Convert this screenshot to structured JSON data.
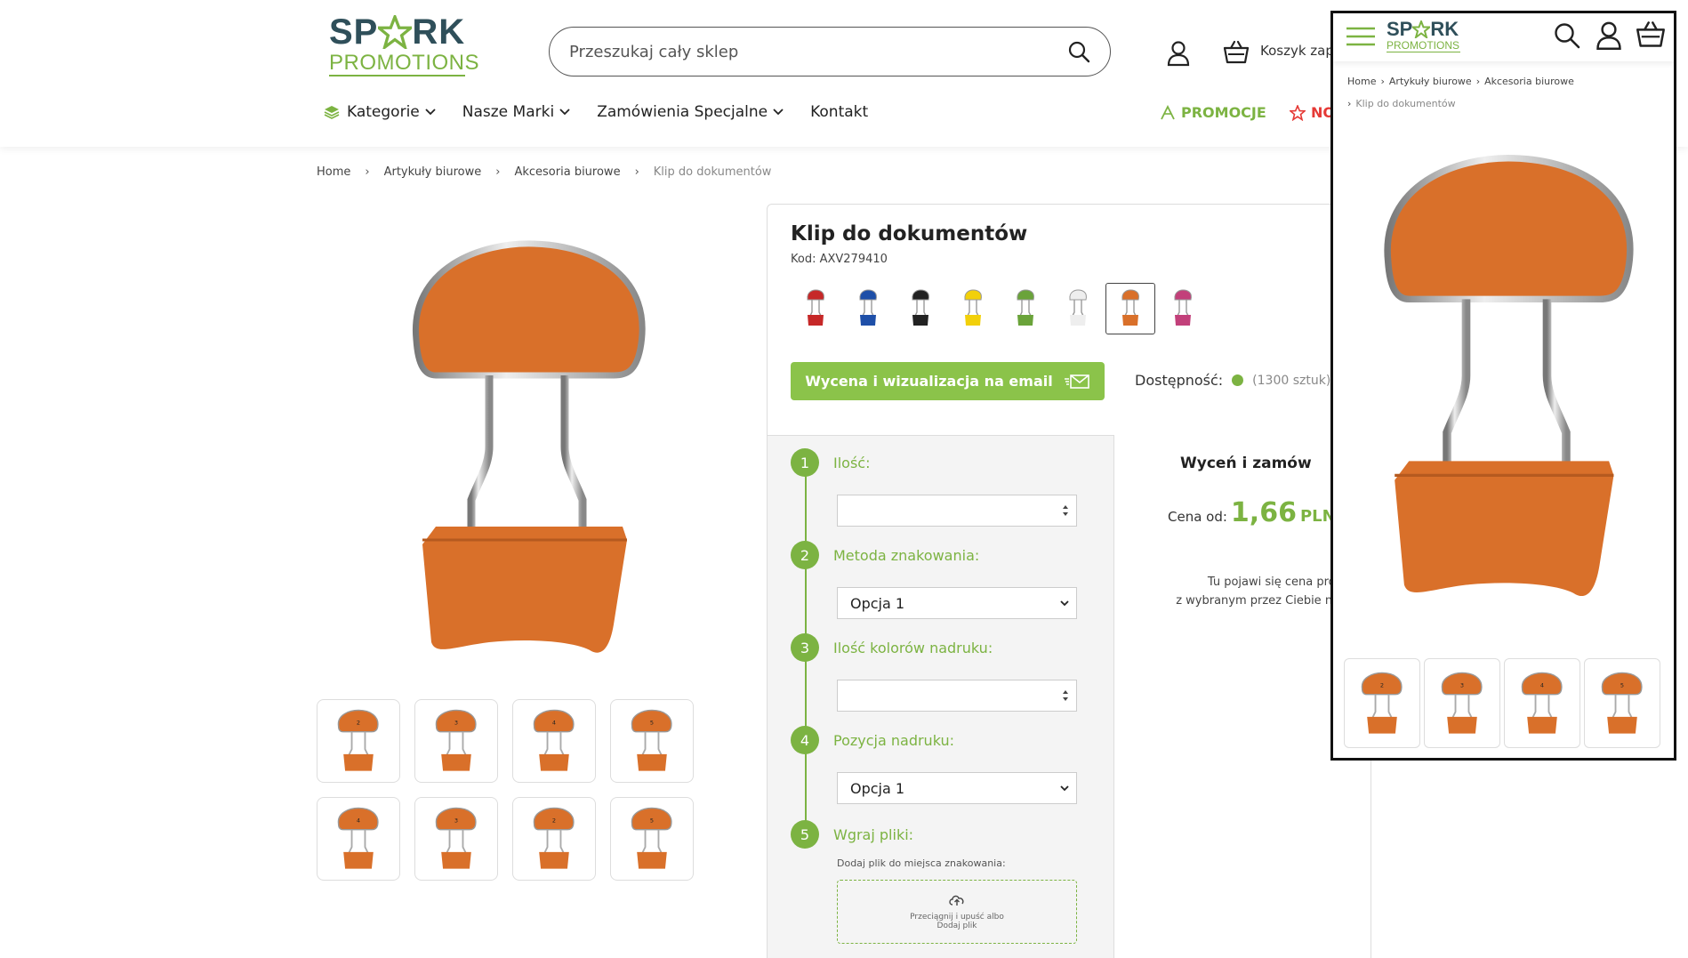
{
  "colors": {
    "accent": "#7cb342",
    "accent_btn": "#8bc34a",
    "logo_dark": "#2f4f5a",
    "product_orange": "#d9702a",
    "new_red": "#e53935"
  },
  "header": {
    "logo_top": "SP★RK",
    "logo_bottom": "PROMOTIONS",
    "search_placeholder": "Przeszukaj cały sklep",
    "cart_label": "Koszyk zap"
  },
  "nav": {
    "items": [
      {
        "label": "Kategorie",
        "icon": "layers-icon",
        "dropdown": true
      },
      {
        "label": "Nasze Marki",
        "dropdown": true
      },
      {
        "label": "Zamówienia Specjalne",
        "dropdown": true
      },
      {
        "label": "Kontakt",
        "dropdown": false
      }
    ],
    "promo_label": "PROMOCJE",
    "new_label": "NO"
  },
  "breadcrumb": [
    "Home",
    "Artykuły biurowe",
    "Akcesoria biurowe",
    "Klip do dokumentów"
  ],
  "gallery": {
    "thumb_numbers": [
      "2",
      "3",
      "4",
      "5",
      "4",
      "3",
      "2",
      "5"
    ]
  },
  "product": {
    "title": "Klip do dokumentów",
    "code": "Kod: AXV279410",
    "swatches": [
      {
        "name": "red",
        "color": "#c62828"
      },
      {
        "name": "blue",
        "color": "#1e4fa8"
      },
      {
        "name": "black",
        "color": "#222222"
      },
      {
        "name": "yellow",
        "color": "#f2d00a"
      },
      {
        "name": "green",
        "color": "#6aa33a"
      },
      {
        "name": "white",
        "color": "#eeeeee"
      },
      {
        "name": "orange",
        "color": "#d9702a",
        "selected": true
      },
      {
        "name": "pink",
        "color": "#c2407a"
      }
    ],
    "cta_label": "Wycena i wizualizacja na email",
    "availability_label": "Dostępność:",
    "availability_stock": "(1300 sztuk)"
  },
  "form": {
    "steps": [
      {
        "num": "1",
        "label": "Ilość:",
        "type": "number",
        "value": ""
      },
      {
        "num": "2",
        "label": "Metoda znakowania:",
        "type": "select",
        "value": "Opcja 1"
      },
      {
        "num": "3",
        "label": "Ilość kolorów nadruku:",
        "type": "number",
        "value": ""
      },
      {
        "num": "4",
        "label": "Pozycja nadruku:",
        "type": "select",
        "value": "Opcja 1"
      },
      {
        "num": "5",
        "label": "Wgraj pliki:",
        "type": "upload"
      }
    ],
    "upload_hint": "Dodaj plik do miejsca znakowania:",
    "dropzone_line1": "Przeciągnij i upuść albo",
    "dropzone_line2": "Dodaj plik"
  },
  "price": {
    "title": "Wyceń i zamów",
    "from_label": "Cena od:",
    "value": "1,66",
    "currency": "PLN",
    "note_line1": "Tu pojawi się cena produktu",
    "note_line2": "z wybranym przez Ciebie nadruki"
  },
  "mobile": {
    "logo_top": "SP★RK",
    "logo_bottom": "PROMOTIONS",
    "breadcrumb": [
      "Home",
      "Artykuły biurowe",
      "Akcesoria biurowe",
      "Klip do dokumentów"
    ],
    "thumb_numbers": [
      "2",
      "3",
      "4",
      "5"
    ]
  }
}
